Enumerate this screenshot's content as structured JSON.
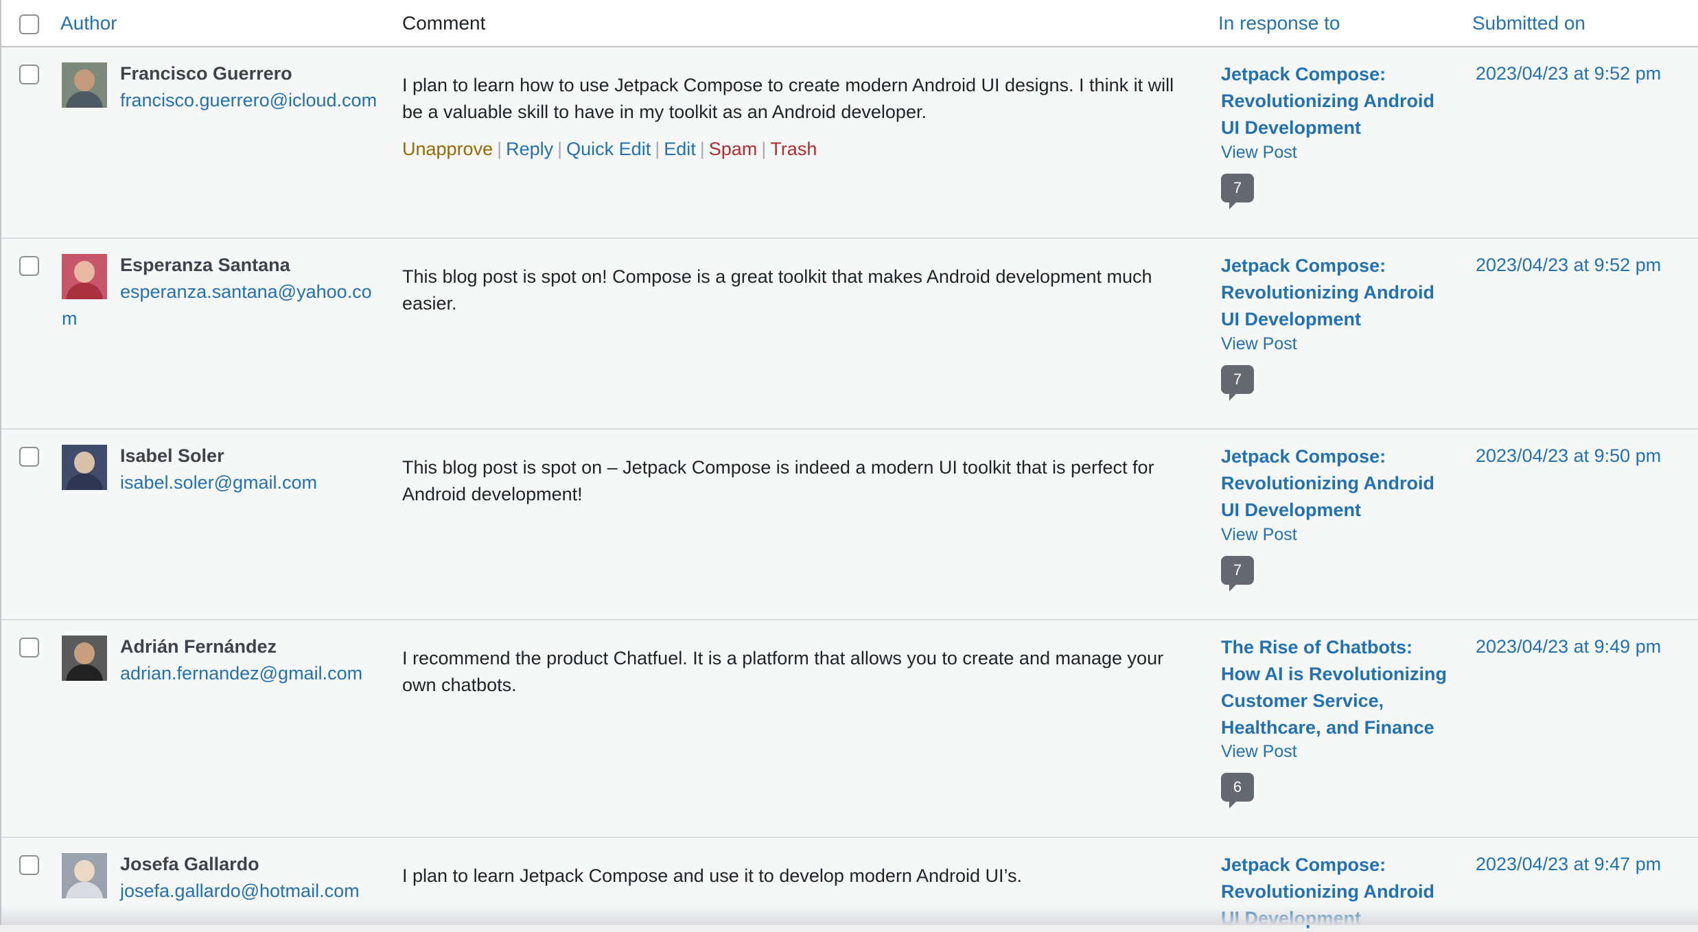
{
  "header": {
    "author": "Author",
    "comment": "Comment",
    "in_response_to": "In response to",
    "submitted_on": "Submitted on"
  },
  "colors": {
    "link": "#2271b1",
    "unapprove": "#996800",
    "spam_trash": "#b32d2e",
    "count_badge": "#646970"
  },
  "rows": [
    {
      "author_name": "Francisco Guerrero",
      "author_email": "francisco.guerrero@icloud.com",
      "comment": "I plan to learn how to use Jetpack Compose to create modern Android UI designs. I think it will be a valuable skill to have in my toolkit as an Android developer.",
      "actions": {
        "unapprove": "Unapprove",
        "reply": "Reply",
        "quick_edit": "Quick Edit",
        "edit": "Edit",
        "spam": "Spam",
        "trash": "Trash",
        "separator": "|"
      },
      "post_title": "Jetpack Compose: Revolutionizing Android UI Development",
      "view_post": "View Post",
      "comment_count": "7",
      "submitted": "2023/04/23 at 9:52 pm"
    },
    {
      "author_name": "Esperanza Santana",
      "author_email": "esperanza.santana@yahoo.com",
      "comment": "This blog post is spot on! Compose is a great toolkit that makes Android development much easier.",
      "post_title": "Jetpack Compose: Revolutionizing Android UI Development",
      "view_post": "View Post",
      "comment_count": "7",
      "submitted": "2023/04/23 at 9:52 pm"
    },
    {
      "author_name": "Isabel Soler",
      "author_email": "isabel.soler@gmail.com",
      "comment": "This blog post is spot on – Jetpack Compose is indeed a modern UI toolkit that is perfect for Android development!",
      "post_title": "Jetpack Compose: Revolutionizing Android UI Development",
      "view_post": "View Post",
      "comment_count": "7",
      "submitted": "2023/04/23 at 9:50 pm"
    },
    {
      "author_name": "Adrián Fernández",
      "author_email": "adrian.fernandez@gmail.com",
      "comment": "I recommend the product Chatfuel. It is a platform that allows you to create and manage your own chatbots.",
      "post_title": "The Rise of Chatbots: How AI is Revolutionizing Customer Service, Healthcare, and Finance",
      "view_post": "View Post",
      "comment_count": "6",
      "submitted": "2023/04/23 at 9:49 pm"
    },
    {
      "author_name": "Josefa Gallardo",
      "author_email": "josefa.gallardo@hotmail.com",
      "comment": "I plan to learn Jetpack Compose and use it to develop modern Android UI’s.",
      "post_title": "Jetpack Compose: Revolutionizing Android UI Development",
      "submitted": "2023/04/23 at 9:47 pm"
    }
  ]
}
